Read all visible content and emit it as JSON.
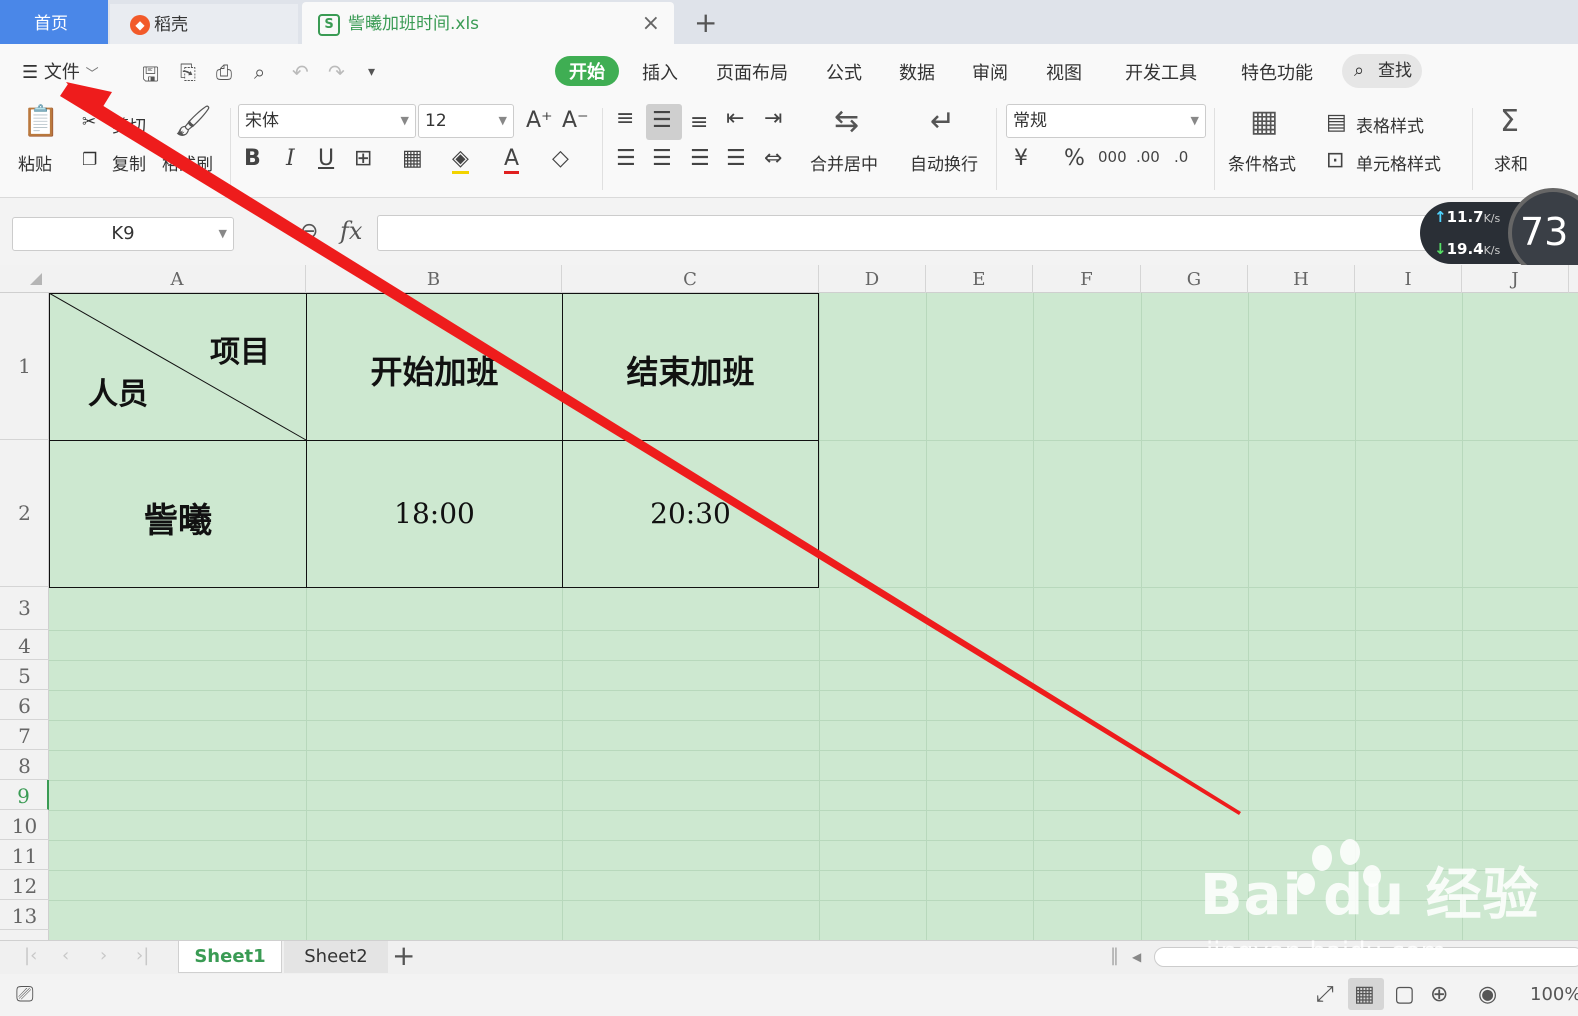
{
  "titlebar": {
    "home_tab": "首页",
    "dk_tab": "稻壳",
    "file_tab": "訾曦加班时间.xls",
    "file_icon": "S",
    "close_glyph": "×",
    "add_glyph": "+"
  },
  "menubar": {
    "file_label": "文件",
    "tabs": [
      "开始",
      "插入",
      "页面布局",
      "公式",
      "数据",
      "审阅",
      "视图",
      "开发工具",
      "特色功能"
    ],
    "search_label": "查找"
  },
  "ribbon": {
    "paste": "粘贴",
    "cut": "剪切",
    "copy": "复制",
    "format_painter": "格式刷",
    "font_name": "宋体",
    "font_size": "12",
    "merge_center": "合并居中",
    "wrap_text": "自动换行",
    "number_format": "常规",
    "conditional_format": "条件格式",
    "table_style": "表格样式",
    "cell_style": "单元格样式",
    "sum": "求和"
  },
  "formula": {
    "name_box": "K9",
    "fx_label": "fx"
  },
  "network": {
    "up": "11.7",
    "down": "19.4",
    "unit": "K/s",
    "cpu": "73"
  },
  "grid": {
    "columns": [
      "A",
      "B",
      "C",
      "D",
      "E",
      "F",
      "G",
      "H",
      "I",
      "J"
    ],
    "rows": [
      "1",
      "2",
      "3",
      "4",
      "5",
      "6",
      "7",
      "8",
      "9",
      "10",
      "11",
      "12",
      "13"
    ],
    "selected_row": "9",
    "cells": {
      "A1_top": "项目",
      "A1_bottom": "人员",
      "B1": "开始加班",
      "C1": "结束加班",
      "A2": "訾曦",
      "B2": "18:00",
      "C2": "20:30"
    }
  },
  "sheets": {
    "active": "Sheet1",
    "other": "Sheet2"
  },
  "status": {
    "zoom": "100%"
  },
  "watermark": {
    "main": "Bai du 经验",
    "sub": "jingyan.baidu.com"
  },
  "colors": {
    "accent_green": "#3fae53",
    "grid_bg": "#cde8d0",
    "home_blue": "#4a87e8",
    "annotation_red": "#ee1c1c"
  }
}
